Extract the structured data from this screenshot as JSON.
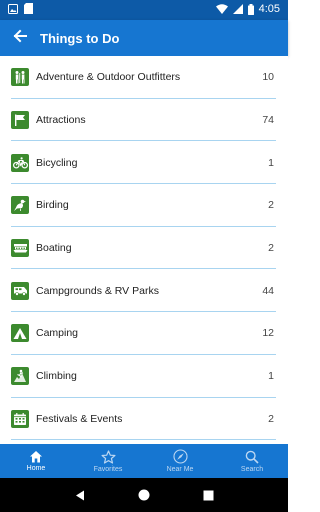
{
  "status_bar": {
    "time": "4:05"
  },
  "app_bar": {
    "title": "Things to Do"
  },
  "categories": [
    {
      "label": "Adventure & Outdoor Outfitters",
      "count": "10",
      "icon": "hikers-icon"
    },
    {
      "label": "Attractions",
      "count": "74",
      "icon": "flag-icon"
    },
    {
      "label": "Bicycling",
      "count": "1",
      "icon": "bicycle-icon"
    },
    {
      "label": "Birding",
      "count": "2",
      "icon": "bird-icon"
    },
    {
      "label": "Boating",
      "count": "2",
      "icon": "boat-icon"
    },
    {
      "label": "Campgrounds & RV Parks",
      "count": "44",
      "icon": "rv-icon"
    },
    {
      "label": "Camping",
      "count": "12",
      "icon": "tent-icon"
    },
    {
      "label": "Climbing",
      "count": "1",
      "icon": "climber-icon"
    },
    {
      "label": "Festivals & Events",
      "count": "2",
      "icon": "calendar-icon"
    }
  ],
  "bottom_nav": {
    "home": "Home",
    "favorites": "Favorites",
    "near_me": "Near Me",
    "search": "Search"
  },
  "colors": {
    "primary": "#1676d1",
    "status_bar": "#0d5aa7",
    "icon_green": "#3c8a2e",
    "divider": "#a8d4f0"
  }
}
